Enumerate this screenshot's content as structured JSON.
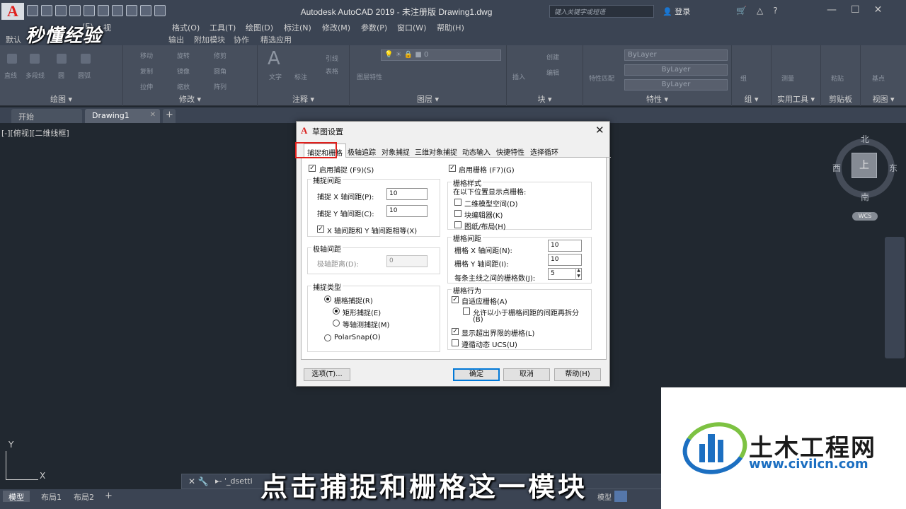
{
  "app": {
    "logo": "A",
    "title": "Autodesk AutoCAD 2019 - 未注册版     Drawing1.dwg",
    "search_placeholder": "键入关键字或短语",
    "login": "登录",
    "win_controls": [
      "—",
      "☐",
      "✕"
    ]
  },
  "menubar": [
    "(E)",
    "视",
    "格式(O)",
    "工具(T)",
    "绘图(D)",
    "标注(N)",
    "修改(M)",
    "参数(P)",
    "窗口(W)",
    "帮助(H)"
  ],
  "ribbon_tabs": [
    "默认",
    "输出",
    "附加模块",
    "协作",
    "精选应用"
  ],
  "ribbon": {
    "panels": [
      "绘图 ▾",
      "修改 ▾",
      "注释 ▾",
      "图层 ▾",
      "块 ▾",
      "特性 ▾",
      "组 ▾",
      "实用工具 ▾",
      "剪贴板",
      "视图 ▾"
    ],
    "layer_value": "0",
    "bylayer": [
      "ByLayer",
      "ByLayer",
      "ByLayer"
    ],
    "labels": {
      "line": "直线",
      "polyline": "多段线",
      "circle": "圆",
      "arc": "圆弧",
      "move": "移动",
      "rotate": "旋转",
      "trim": "修剪",
      "copy": "复制",
      "mirror": "镜像",
      "fillet": "圆角",
      "stretch": "拉伸",
      "scale": "缩放",
      "array": "阵列",
      "text": "文字",
      "dimension": "标注",
      "leader": "引线",
      "table": "表格",
      "layer_props": "图层特性",
      "insert": "插入",
      "create": "创建",
      "edit": "编辑",
      "match": "特性匹配",
      "group": "组",
      "measure": "测量",
      "paste": "粘贴",
      "base": "基点"
    }
  },
  "doc_tabs": [
    "开始",
    "Drawing1"
  ],
  "viewport": {
    "label": "[-][俯视][二维线框]",
    "viewcube": {
      "top": "上",
      "n": "北",
      "s": "南",
      "e": "东",
      "w": "西",
      "wcs": "WCS"
    },
    "ucs": {
      "y": "Y",
      "x": "X"
    }
  },
  "cmdline": {
    "text": "▸- '_dsetti"
  },
  "layout_tabs": [
    "模型",
    "布局1",
    "布局2"
  ],
  "status": {
    "model": "模型"
  },
  "watermark": "秒懂经验",
  "subtitle": "点击捕捉和栅格这一模块",
  "brand": {
    "name_cn": "土木工程网",
    "url": "www.civilcn.com"
  },
  "dialog": {
    "title": "草图设置",
    "tabs": [
      "捕捉和栅格",
      "极轴追踪",
      "对象捕捉",
      "三维对象捕捉",
      "动态输入",
      "快捷特性",
      "选择循环"
    ],
    "snap_on": "启用捕捉 (F9)(S)",
    "snap_spacing_title": "捕捉间距",
    "snap_x_label": "捕捉 X 轴间距(P):",
    "snap_x_value": "10",
    "snap_y_label": "捕捉 Y 轴间距(C):",
    "snap_y_value": "10",
    "equal_xy": "X 轴间距和 Y 轴间距相等(X)",
    "polar_spacing_title": "极轴间距",
    "polar_distance_label": "极轴距离(D):",
    "polar_distance_value": "0",
    "snap_type_title": "捕捉类型",
    "grid_snap": "栅格捕捉(R)",
    "rect_snap": "矩形捕捉(E)",
    "iso_snap": "等轴测捕捉(M)",
    "polar_snap": "PolarSnap(O)",
    "grid_on": "启用栅格 (F7)(G)",
    "grid_style_title": "栅格样式",
    "grid_style_desc": "在以下位置显示点栅格:",
    "model_space": "二维模型空间(D)",
    "block_editor": "块编辑器(K)",
    "sheet_layout": "图纸/布局(H)",
    "grid_spacing_title": "栅格间距",
    "grid_x_label": "栅格 X 轴间距(N):",
    "grid_x_value": "10",
    "grid_y_label": "栅格 Y 轴间距(I):",
    "grid_y_value": "10",
    "major_label": "每条主线之间的栅格数(J):",
    "major_value": "5",
    "grid_behavior_title": "栅格行为",
    "adaptive": "自适应栅格(A)",
    "subdivide": "允许以小于栅格间距的间距再拆分",
    "subdivide_key": "(B)",
    "beyond_limits": "显示超出界限的栅格(L)",
    "follow_ucs": "遵循动态 UCS(U)",
    "options_btn": "选项(T)...",
    "ok_btn": "确定",
    "cancel_btn": "取消",
    "help_btn": "帮助(H)"
  }
}
